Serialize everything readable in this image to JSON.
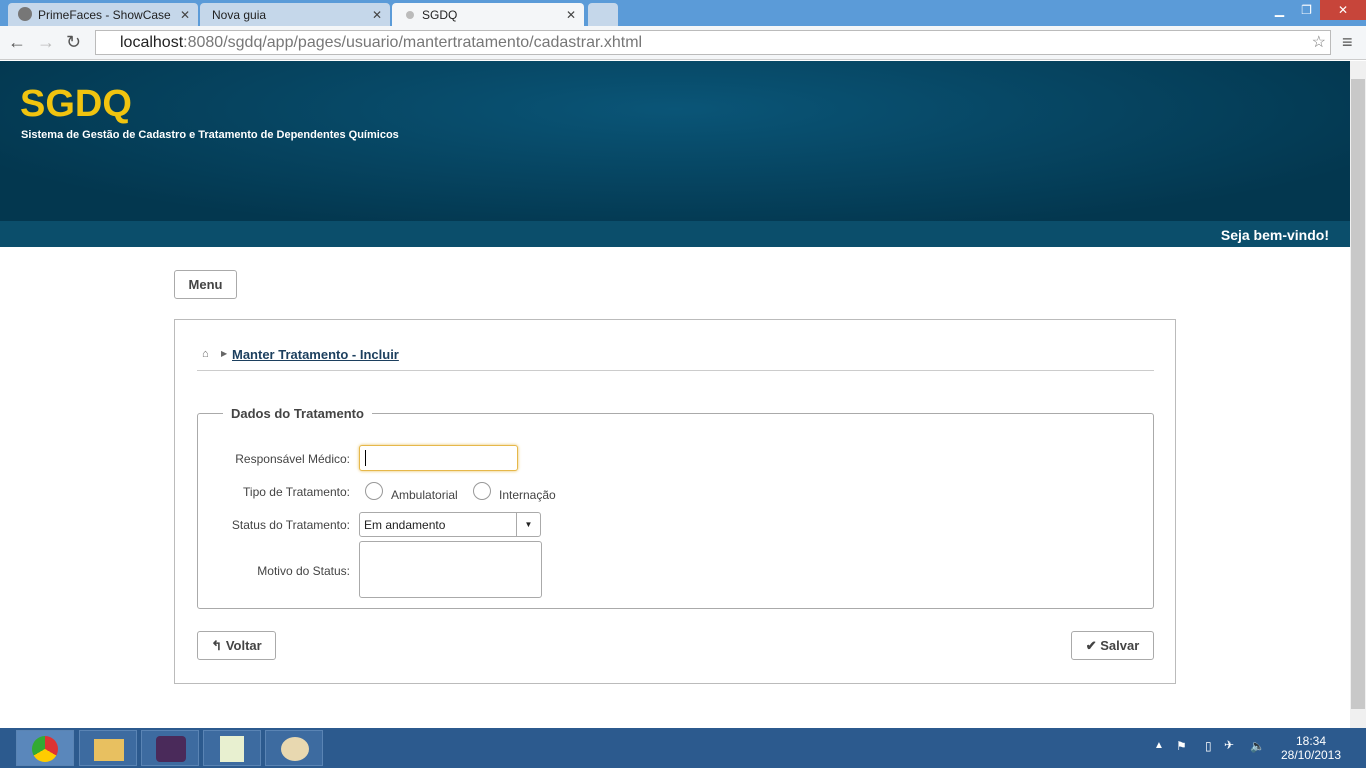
{
  "browser": {
    "tabs": [
      {
        "label": "PrimeFaces - ShowCase"
      },
      {
        "label": "Nova guia"
      },
      {
        "label": "SGDQ"
      }
    ],
    "url_host": "localhost",
    "url_rest": ":8080/sgdq/app/pages/usuario/mantertratamento/cadastrar.xhtml"
  },
  "header": {
    "title": "SGDQ",
    "subtitle": "Sistema de Gestão de Cadastro e Tratamento de Dependentes Químicos",
    "welcome": "Seja bem-vindo!"
  },
  "menu_label": "Menu",
  "breadcrumb": "Manter Tratamento - Incluir",
  "form": {
    "legend": "Dados do Tratamento",
    "responsavel_label": "Responsável Médico:",
    "responsavel_value": "",
    "tipo_label": "Tipo de Tratamento:",
    "tipo_options": [
      "Ambulatorial",
      "Internação"
    ],
    "status_label": "Status do Tratamento:",
    "status_value": "Em andamento",
    "motivo_label": "Motivo do Status:"
  },
  "buttons": {
    "back": "Voltar",
    "save": "Salvar"
  },
  "taskbar": {
    "time": "18:34",
    "date": "28/10/2013"
  }
}
